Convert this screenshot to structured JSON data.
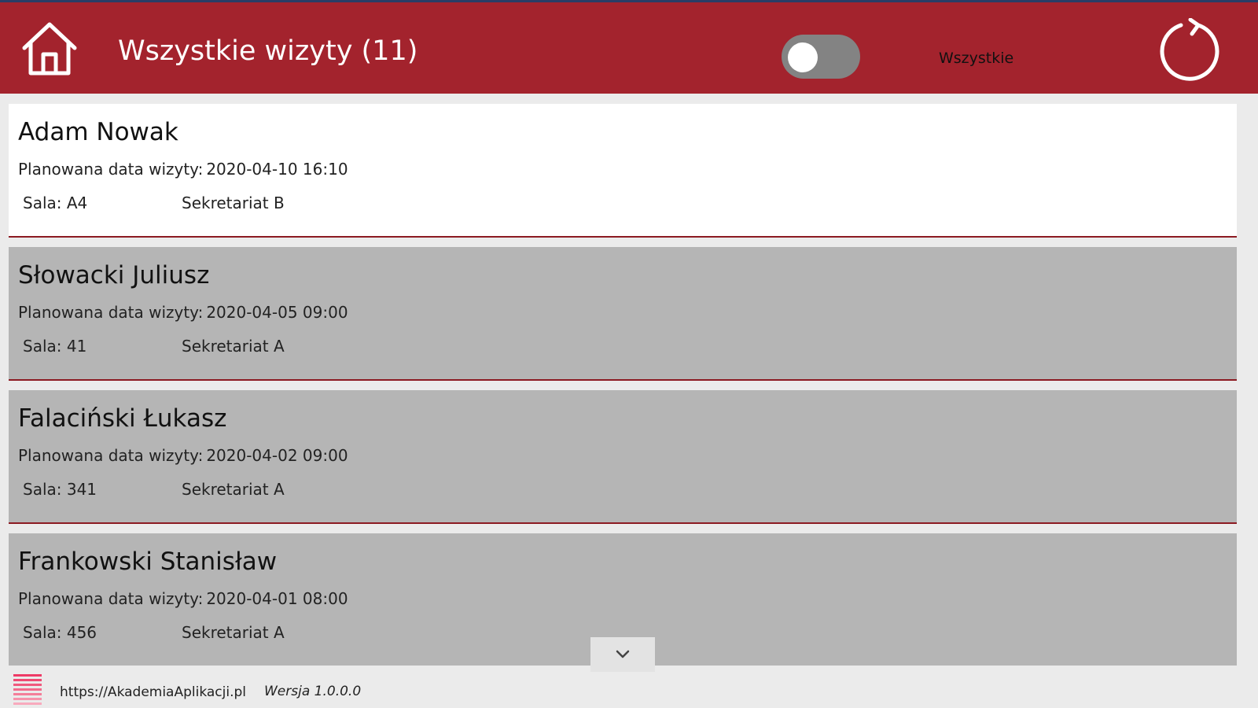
{
  "header": {
    "title": "Wszystkie wizyty (11)",
    "toggle_on": false,
    "toggle_label": "Wszystkie",
    "background_color": "#a3232d",
    "home_icon": "home-icon",
    "refresh_icon": "refresh-icon"
  },
  "visits": [
    {
      "name": "Adam Nowak",
      "date_label": "Planowana data wizyty:",
      "date": "2020-04-10 16:10",
      "room": "Sala: A4",
      "office": "Sekretariat B",
      "selected": true
    },
    {
      "name": "Słowacki Juliusz",
      "date_label": "Planowana data wizyty:",
      "date": "2020-04-05 09:00",
      "room": "Sala: 41",
      "office": "Sekretariat A",
      "selected": false
    },
    {
      "name": "Falaciński Łukasz",
      "date_label": "Planowana data wizyty:",
      "date": "2020-04-02 09:00",
      "room": "Sala: 341",
      "office": "Sekretariat A",
      "selected": false
    },
    {
      "name": "Frankowski Stanisław",
      "date_label": "Planowana data wizyty:",
      "date": "2020-04-01 08:00",
      "room": "Sala: 456",
      "office": "Sekretariat A",
      "selected": false
    }
  ],
  "scroll_icon": "chevron-down-icon",
  "footer": {
    "logo_icon": "app-logo-icon",
    "url": "https://AkademiaAplikacji.pl",
    "version": "Wersja 1.0.0.0"
  }
}
